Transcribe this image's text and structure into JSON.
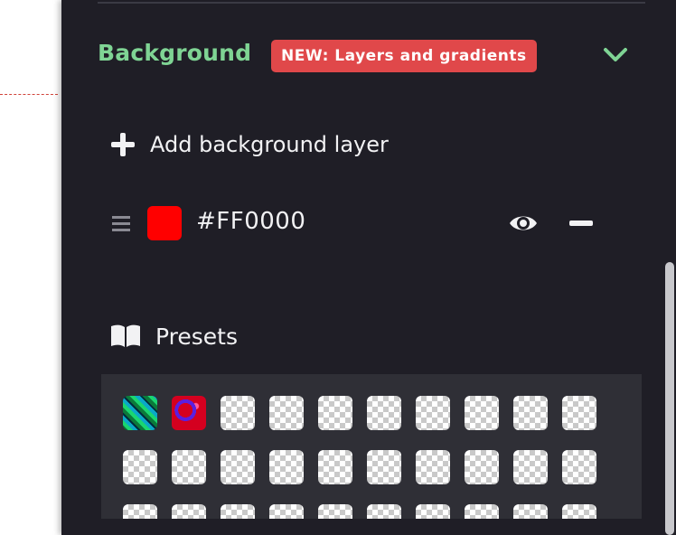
{
  "background_section": {
    "title": "Background",
    "badge": "NEW: Layers and gradients",
    "add_layer_label": "Add background layer",
    "layers": [
      {
        "hex": "#FF0000",
        "color": "#FF0000",
        "visible": true
      }
    ],
    "presets_label": "Presets"
  },
  "colors": {
    "panel_bg": "#1f1e26",
    "accent_green": "#7fd494",
    "badge_red": "#e0484a"
  },
  "icons": {
    "collapse": "chevron-down-icon",
    "add": "plus-icon",
    "drag": "drag-handle-icon",
    "visibility": "eye-icon",
    "remove": "minus-icon",
    "presets": "book-icon"
  }
}
